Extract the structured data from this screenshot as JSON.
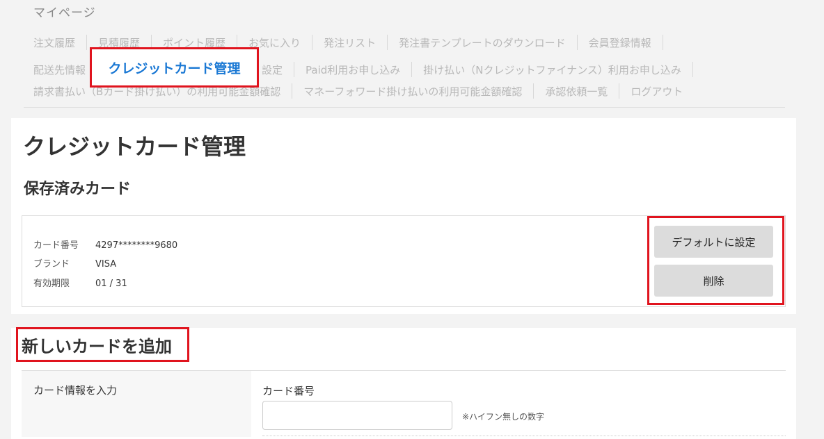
{
  "page_label": "マイページ",
  "nav": {
    "row1": [
      "注文履歴",
      "見積履歴",
      "ポイント履歴",
      "お気に入り",
      "発注リスト",
      "発注書テンプレートのダウンロード",
      "会員登録情報"
    ],
    "row2_a": "配送先情報",
    "row2_b": [
      "設定",
      "Paid利用お申し込み",
      "掛け払い（Nクレジットファイナンス）利用お申し込み"
    ],
    "row3": [
      "請求書払い（Bカード掛け払い）の利用可能金額確認",
      "マネーフォワード掛け払いの利用可能金額確認",
      "承認依頼一覧",
      "ログアウト"
    ],
    "active": "クレジットカード管理"
  },
  "page_title": "クレジットカード管理",
  "saved_cards": {
    "title": "保存済みカード",
    "card": {
      "number_label": "カード番号",
      "number_value": "4297********9680",
      "brand_label": "ブランド",
      "brand_value": "VISA",
      "expiry_label": "有効期限",
      "expiry_value": "01 / 31"
    },
    "default_button": "デフォルトに設定",
    "delete_button": "削除"
  },
  "add_card": {
    "title": "新しいカードを追加",
    "section_label": "カード情報を入力",
    "card_number_label": "カード番号",
    "card_number_value": "",
    "hint": "※ハイフン無しの数字"
  },
  "colors": {
    "highlight_red": "#e0141e",
    "active_link_blue": "#1a78d4",
    "nav_text_gray": "#b8b8b8",
    "button_gray": "#dcdcdc"
  }
}
